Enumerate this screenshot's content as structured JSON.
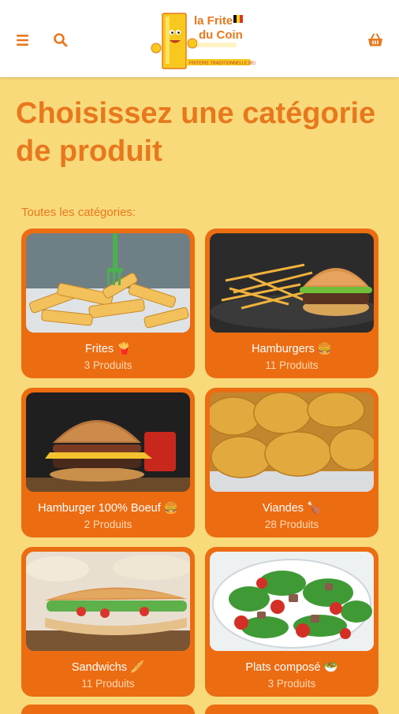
{
  "header": {
    "menu_icon": "hamburger-menu-icon",
    "search_icon": "search-icon",
    "cart_icon": "basket-icon",
    "logo": {
      "brand_line1": "la Frite",
      "brand_line2": "du Coin",
      "tagline": "FRITERIE TRADITIONNELLE BELGE"
    }
  },
  "page": {
    "title": "Choisissez une catégorie de produit",
    "section_label": "Toutes les catégories:"
  },
  "categories": [
    {
      "name": "Frites 🍟",
      "count": "3 Produits"
    },
    {
      "name": "Hamburgers 🍔",
      "count": "11 Produits"
    },
    {
      "name": "Hamburger 100% Boeuf 🍔",
      "count": "2 Produits"
    },
    {
      "name": "Viandes 🍗",
      "count": "28 Produits"
    },
    {
      "name": "Sandwichs 🥖",
      "count": "11 Produits"
    },
    {
      "name": "Plats composé 🥗",
      "count": "3 Produits"
    }
  ],
  "colors": {
    "background": "#f8da7a",
    "accent": "#e8781d",
    "card": "#ec6c12",
    "header": "#ffffff"
  }
}
